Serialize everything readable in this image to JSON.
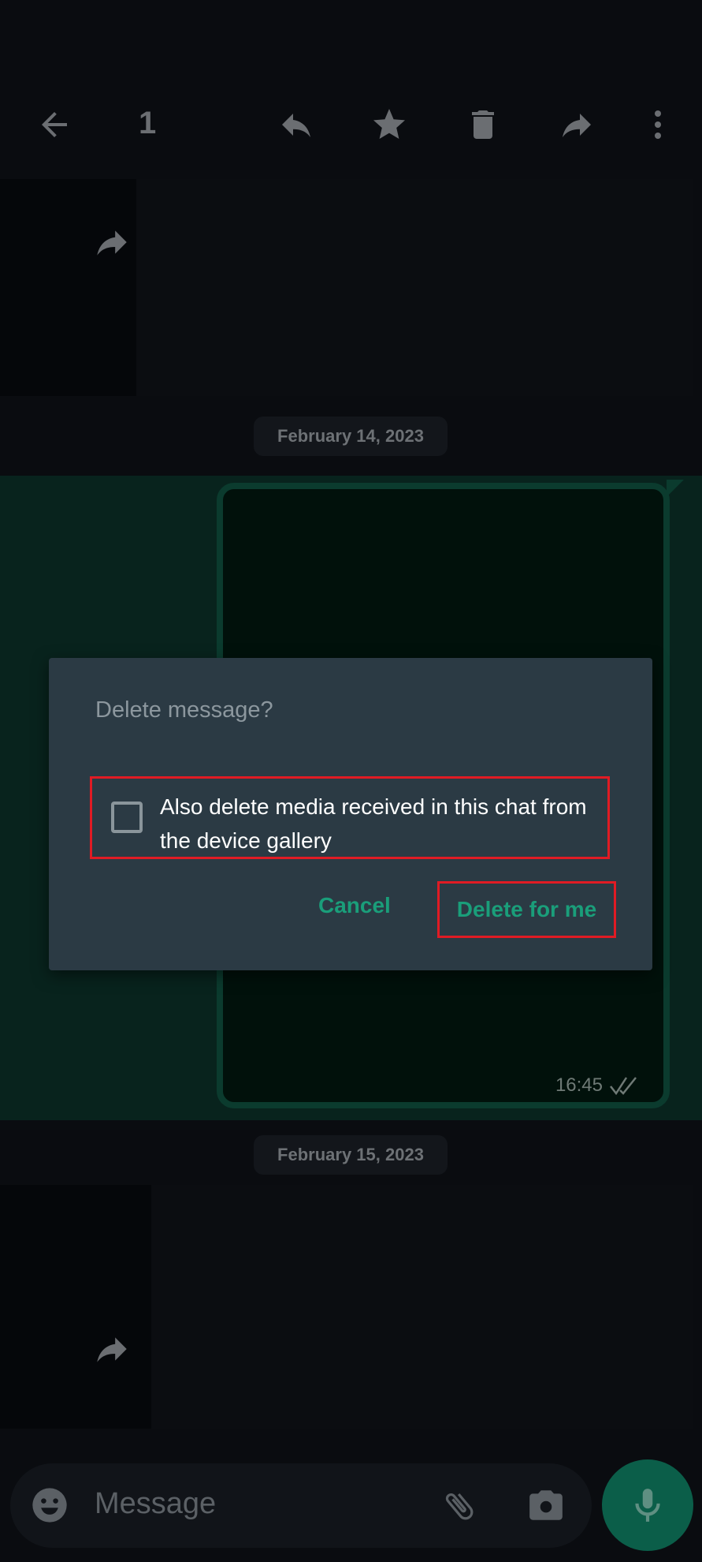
{
  "toolbar": {
    "selected_count": "1",
    "icons": [
      "back-arrow-icon",
      "reply-icon",
      "star-icon",
      "delete-icon",
      "forward-icon",
      "more-vert-icon"
    ]
  },
  "chat": {
    "date_1": "February 14, 2023",
    "date_2": "February 15, 2023",
    "selected_message_time": "16:45",
    "selected_message_status": "read",
    "accent_color": "#1a9e7a"
  },
  "dialog": {
    "title": "Delete message?",
    "checkbox_label": "Also delete media received in this chat from the device gallery",
    "checkbox_checked": false,
    "cancel_label": "Cancel",
    "delete_label": "Delete for me",
    "highlight_color": "#e01b24"
  },
  "composer": {
    "placeholder": "Message"
  }
}
